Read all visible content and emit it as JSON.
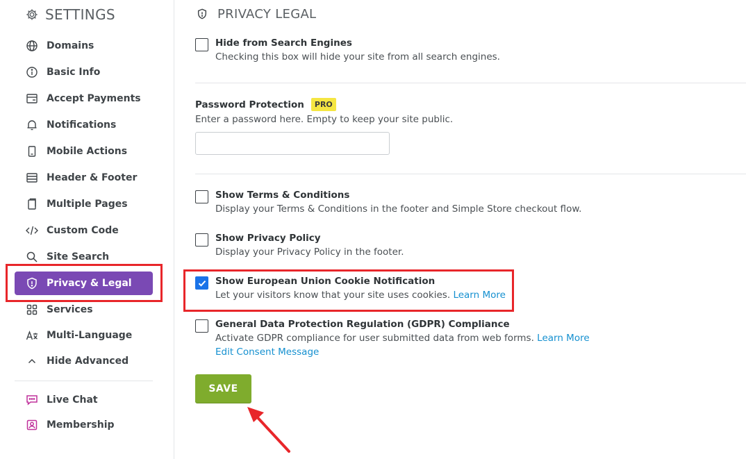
{
  "sidebar": {
    "title": "SETTINGS",
    "items": [
      {
        "label": "Domains",
        "icon": "globe-icon"
      },
      {
        "label": "Basic Info",
        "icon": "info-icon"
      },
      {
        "label": "Accept Payments",
        "icon": "card-icon"
      },
      {
        "label": "Notifications",
        "icon": "bell-icon"
      },
      {
        "label": "Mobile Actions",
        "icon": "mobile-icon"
      },
      {
        "label": "Header & Footer",
        "icon": "layout-icon"
      },
      {
        "label": "Multiple Pages",
        "icon": "pages-icon"
      },
      {
        "label": "Custom Code",
        "icon": "code-icon"
      },
      {
        "label": "Site Search",
        "icon": "search-icon"
      },
      {
        "label": "Privacy & Legal",
        "icon": "shield-icon",
        "active": true
      },
      {
        "label": "Services",
        "icon": "grid-icon"
      },
      {
        "label": "Multi-Language",
        "icon": "translate-icon"
      },
      {
        "label": "Hide Advanced",
        "icon": "chevron-up-icon"
      }
    ],
    "extras": [
      {
        "label": "Live Chat",
        "icon": "chat-icon"
      },
      {
        "label": "Membership",
        "icon": "membership-icon"
      }
    ]
  },
  "main": {
    "title": "PRIVACY LEGAL",
    "hide_search": {
      "title": "Hide from Search Engines",
      "desc": "Checking this box will hide your site from all search engines.",
      "checked": false
    },
    "password": {
      "title": "Password Protection",
      "badge": "PRO",
      "desc": "Enter a password here. Empty to keep your site public.",
      "value": "",
      "placeholder": ""
    },
    "terms": {
      "title": "Show Terms & Conditions",
      "desc": "Display your Terms & Conditions in the footer and Simple Store checkout flow.",
      "checked": false
    },
    "privacy_policy": {
      "title": "Show Privacy Policy",
      "desc": "Display your Privacy Policy in the footer.",
      "checked": false
    },
    "eu_cookie": {
      "title": "Show European Union Cookie Notification",
      "desc": "Let your visitors know that your site uses cookies.",
      "link": "Learn More",
      "checked": true
    },
    "gdpr": {
      "title": "General Data Protection Regulation (GDPR) Compliance",
      "desc": "Activate GDPR compliance for user submitted data from web forms.",
      "link": "Learn More",
      "link2": "Edit Consent Message",
      "checked": false
    },
    "save_label": "SAVE"
  },
  "colors": {
    "active_nav": "#7a49b4",
    "save_button": "#7fac2d",
    "link": "#1590d0",
    "highlight": "#e8262a",
    "pro_badge": "#f5e642",
    "checkbox_checked": "#1a73e8"
  }
}
